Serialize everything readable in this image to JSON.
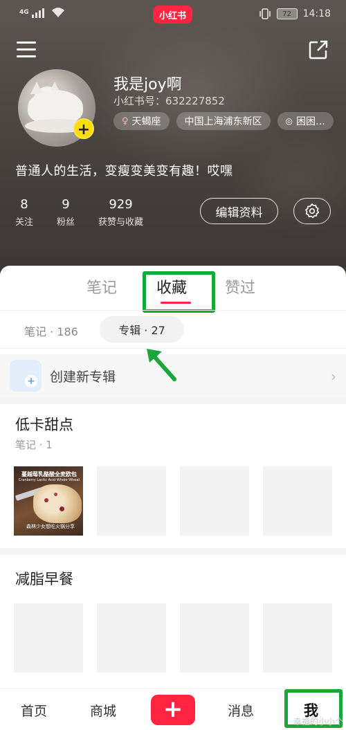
{
  "status_bar": {
    "network": "4G",
    "logo": "小红书",
    "battery": "72",
    "time": "14:18"
  },
  "header": {
    "nickname": "我是joy啊",
    "red_id": "小红书号：632227852",
    "tags": [
      {
        "icon": "female-icon",
        "label": "天蝎座"
      },
      {
        "label": "中国上海浦东新区"
      },
      {
        "icon": "medal-icon",
        "label": "困困…"
      }
    ],
    "bio": "普通人的生活，变瘦变美变有趣！哎嘿",
    "stats": [
      {
        "num": "8",
        "label": "关注"
      },
      {
        "num": "9",
        "label": "粉丝"
      },
      {
        "num": "929",
        "label": "获赞与收藏"
      }
    ],
    "edit_button": "编辑资料"
  },
  "tabs": [
    "笔记",
    "收藏",
    "赞过"
  ],
  "active_tab": "收藏",
  "subtabs": {
    "notes": "笔记 · 186",
    "albums": "专辑 · 27"
  },
  "create_album": "创建新专辑",
  "albums": [
    {
      "title": "低卡甜点",
      "count": "笔记 · 1",
      "photo_caption": "蔓越莓乳酪酸全麦欧包",
      "photo_caption_sub": "Cranberry Lactic Acid Whole Wheat",
      "photo_footer": "森林少女想吃火锅分享"
    },
    {
      "title": "减脂早餐"
    }
  ],
  "bottom_nav": [
    "首页",
    "商城",
    "消息",
    "我"
  ],
  "bottom_nav_add": "+",
  "watermark": "幸福的小小个",
  "colors": {
    "brand_red": "#ff2442",
    "highlight_green": "#1aa63a",
    "avatar_badge": "#ffdd00"
  }
}
